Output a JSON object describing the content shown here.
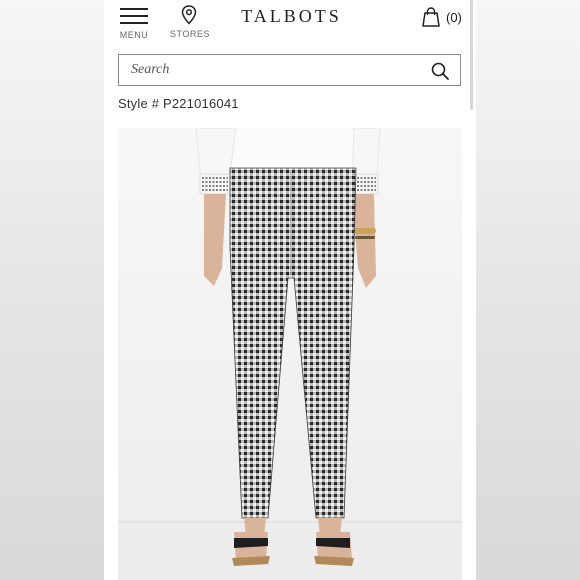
{
  "header": {
    "menu_label": "MENU",
    "stores_label": "STORES",
    "logo_text": "TALBOTS",
    "cart_count": "(0)"
  },
  "search": {
    "placeholder": "Search"
  },
  "product": {
    "style_text": "Style # P221016041"
  },
  "icons": {
    "menu": "hamburger-icon",
    "stores": "map-pin-icon",
    "cart": "shopping-bag-icon",
    "search": "search-icon"
  },
  "colors": {
    "text": "#222222",
    "border": "#8a8a8a",
    "background": "#ffffff"
  }
}
